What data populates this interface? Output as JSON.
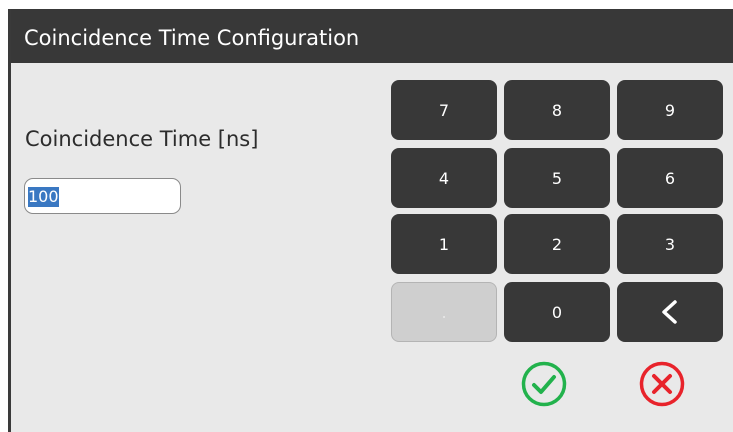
{
  "window": {
    "title": "Coincidence Time Configuration"
  },
  "field": {
    "label": "Coincidence Time [ns]",
    "value": "100"
  },
  "keypad": {
    "k7": "7",
    "k8": "8",
    "k9": "9",
    "k4": "4",
    "k5": "5",
    "k6": "6",
    "k1": "1",
    "k2": "2",
    "k3": "3",
    "dot": ".",
    "k0": "0",
    "back": "<"
  },
  "colors": {
    "title_bar": "#383838",
    "key_bg": "#383838",
    "confirm": "#22b24c",
    "cancel": "#e8232b",
    "selection": "#3a78c2"
  }
}
